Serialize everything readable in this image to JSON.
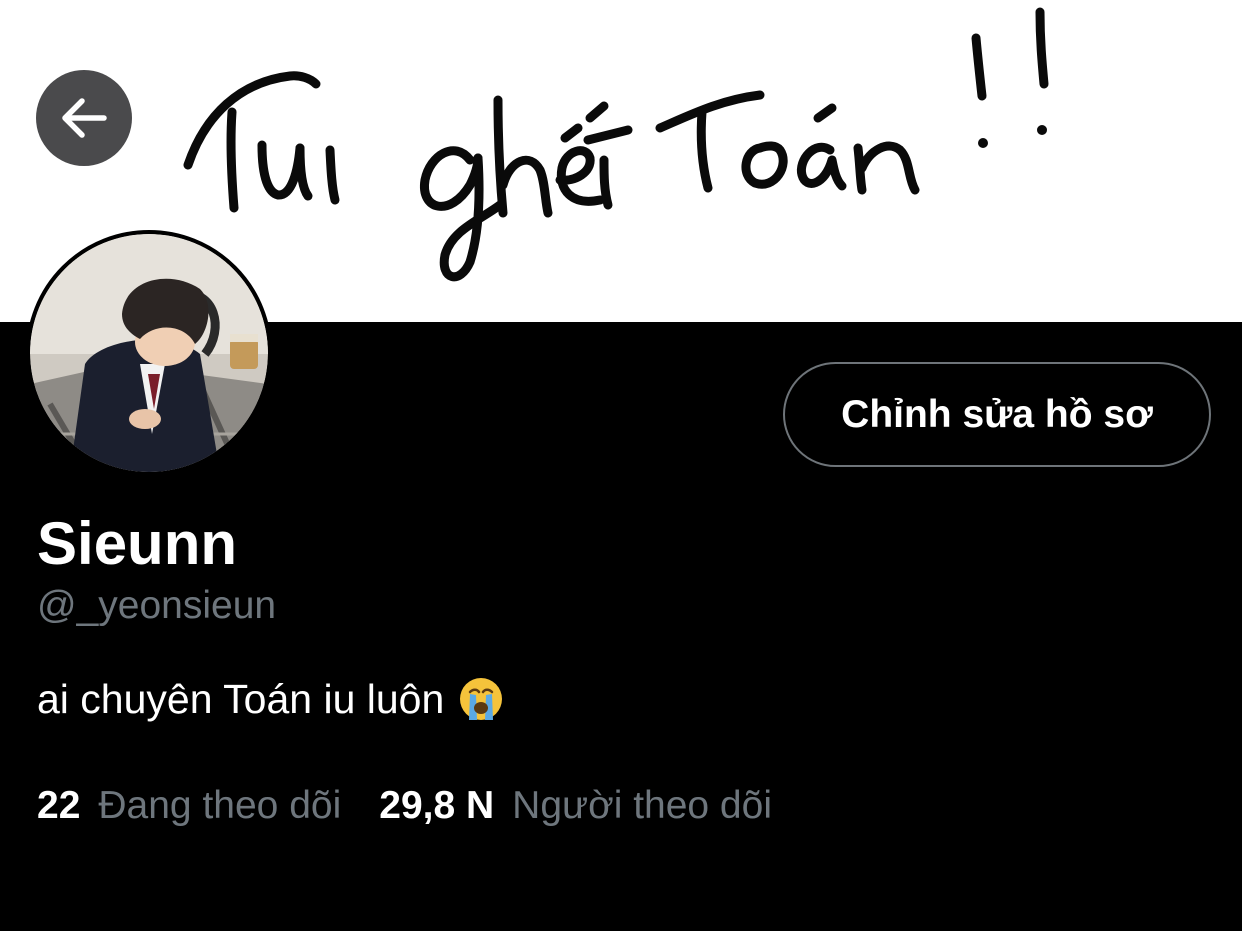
{
  "header": {
    "banner_text": "Tui ghét Toán !!"
  },
  "profile": {
    "display_name": "Sieunn",
    "handle": "@_yeonsieun",
    "bio": "ai chuyên Toán iu luôn",
    "bio_emoji": "crying-face-emoji",
    "edit_button_label": "Chỉnh sửa hồ sơ"
  },
  "stats": {
    "following_count": "22",
    "following_label": "Đang theo dõi",
    "followers_count": "29,8 N",
    "followers_label": "Người theo dõi"
  },
  "icons": {
    "back": "arrow-left-icon"
  },
  "colors": {
    "background": "#000000",
    "muted_text": "#6e767d",
    "button_border": "#6e7479",
    "back_button_bg": "#4a4a4c"
  }
}
